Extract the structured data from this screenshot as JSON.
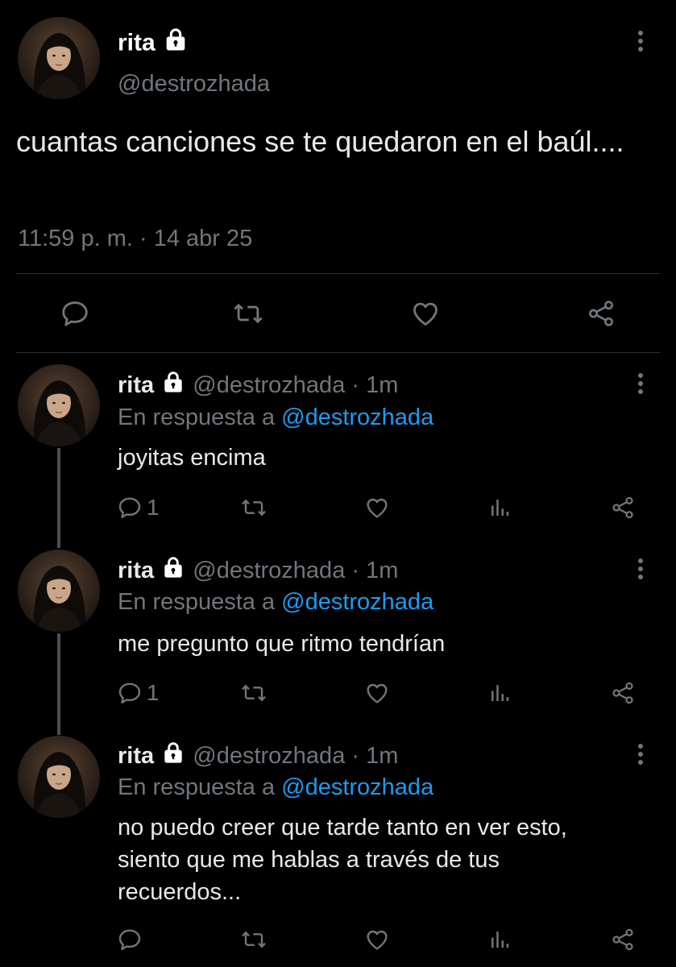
{
  "main_tweet": {
    "name": "rita",
    "handle": "@destrozhada",
    "text": "cuantas canciones se te quedaron en el baúl....",
    "timestamp": "11:59 p. m. · 14 abr 25",
    "actions": [
      "reply-icon",
      "retweet-icon",
      "like-icon",
      "share-icon"
    ]
  },
  "replies": [
    {
      "name": "rita",
      "handle": "@destrozhada",
      "time": "· 1m",
      "reply_prefix": "En respuesta a",
      "reply_to": "@destrozhada",
      "text": "joyitas encima",
      "reply_count": "1"
    },
    {
      "name": "rita",
      "handle": "@destrozhada",
      "time": "· 1m",
      "reply_prefix": "En respuesta a",
      "reply_to": "@destrozhada",
      "text": "me pregunto que ritmo tendrían",
      "reply_count": "1"
    },
    {
      "name": "rita",
      "handle": "@destrozhada",
      "time": "· 1m",
      "reply_prefix": "En respuesta a",
      "reply_to": "@destrozhada",
      "text": "no puedo creer que tarde tanto en ver esto, siento que me hablas a través de tus recuerdos...",
      "reply_count": ""
    }
  ],
  "colors": {
    "background": "#000000",
    "text": "#e7e9ea",
    "secondary": "#71767b",
    "mention": "#1d9bf0",
    "divider": "#2f3336"
  }
}
